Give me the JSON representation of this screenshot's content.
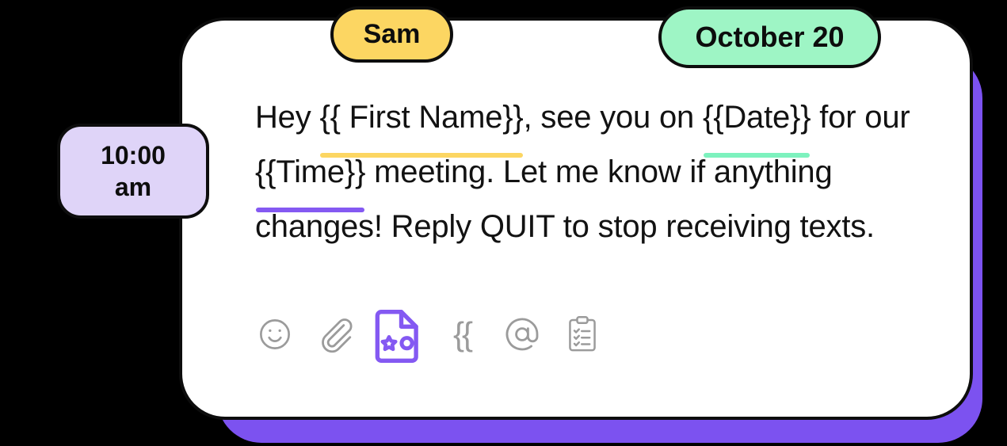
{
  "card": {
    "background": "#FFFFFF",
    "border_color": "#0D0D0D",
    "shadow_color": "#7C52F0"
  },
  "message": {
    "segments": [
      {
        "text": "Hey ",
        "type": "plain"
      },
      {
        "text": "{{ First Name}}",
        "type": "merge-tag",
        "accent": "#FCD662"
      },
      {
        "text": ", see you on ",
        "type": "plain"
      },
      {
        "text": "{{Date}}",
        "type": "merge-tag",
        "accent": "#7DF2BE"
      },
      {
        "text": " for our ",
        "type": "plain"
      },
      {
        "text": "{{Time}}",
        "type": "merge-tag",
        "accent": "#8459F2"
      },
      {
        "text": " meeting. Let me know if anything changes! Reply QUIT to stop receiving texts.",
        "type": "plain"
      }
    ],
    "full_text": "Hey {{ First Name}}, see you on {{Date}} for our {{Time}} meeting. Let me know if anything changes! Reply QUIT to stop receiving texts."
  },
  "badges": {
    "sender": {
      "label": "Sam",
      "color": "#FCD662",
      "tail": "down"
    },
    "date": {
      "label": "October 20",
      "color": "#9EF5C5",
      "tail": "down"
    },
    "time": {
      "line1": "10:00",
      "line2": "am",
      "color": "#DFD4F8",
      "tail": "right"
    }
  },
  "toolbar": {
    "active_color": "#8459F2",
    "idle_color": "#9B9B9B",
    "items": [
      {
        "name": "emoji-icon",
        "label": "Emoji",
        "active": false
      },
      {
        "name": "paperclip-icon",
        "label": "Attach file",
        "active": false
      },
      {
        "name": "media-file-icon",
        "label": "Insert media",
        "active": true
      },
      {
        "name": "merge-tag-icon",
        "label": "{{",
        "active": false
      },
      {
        "name": "mention-icon",
        "label": "Mention",
        "active": false
      },
      {
        "name": "checklist-icon",
        "label": "Template",
        "active": false
      }
    ]
  }
}
